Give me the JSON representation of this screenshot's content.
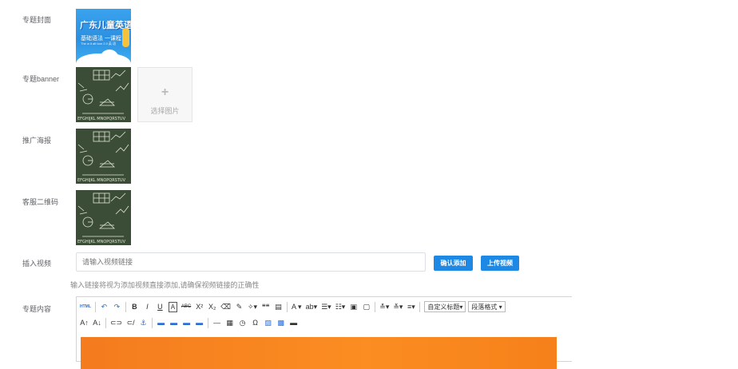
{
  "labels": {
    "cover": "专题封面",
    "banner": "专题banner",
    "poster": "推广海报",
    "qrcode": "客服二维码",
    "video": "插入视频",
    "content": "专题内容"
  },
  "cover_image": {
    "title": "广东儿童英语",
    "subtitle": "基础语法 一课程",
    "small": "The w it alt bon 2.0 英 语"
  },
  "picker": {
    "plus": "+",
    "text": "选择图片"
  },
  "video": {
    "placeholder": "请输入视频链接",
    "confirm_label": "确认添加",
    "upload_label": "上传视频",
    "hint": "输入链接将视为添加视频直接添加,请确保视频链接的正确性"
  },
  "toolbar": {
    "row1": [
      {
        "icon": "html-source-icon",
        "text": "HTML",
        "blue": true
      },
      {
        "sep": true
      },
      {
        "icon": "undo-icon",
        "text": "↶",
        "blue": true
      },
      {
        "icon": "redo-icon",
        "text": "↷",
        "blue": true
      },
      {
        "sep": true
      },
      {
        "icon": "bold-icon",
        "text": "B"
      },
      {
        "icon": "italic-icon",
        "text": "I"
      },
      {
        "icon": "underline-icon",
        "text": "U"
      },
      {
        "icon": "font-border-icon",
        "text": "A"
      },
      {
        "icon": "strikethrough-icon",
        "text": "ABC"
      },
      {
        "icon": "superscript-icon",
        "text": "X²"
      },
      {
        "icon": "subscript-icon",
        "text": "X₂"
      },
      {
        "icon": "eraser-icon",
        "text": "⌫"
      },
      {
        "icon": "format-brush-icon",
        "text": "✎"
      },
      {
        "icon": "auto-format-icon",
        "text": "✧▾"
      },
      {
        "icon": "blockquote-icon",
        "text": "❝❝"
      },
      {
        "icon": "paste-plain-icon",
        "text": "▤"
      },
      {
        "sep": true
      },
      {
        "icon": "font-color-icon",
        "text": "A ▾"
      },
      {
        "icon": "highlight-icon",
        "text": "ab▾"
      },
      {
        "icon": "ordered-list-icon",
        "text": "☰▾"
      },
      {
        "icon": "unordered-list-icon",
        "text": "☷▾"
      },
      {
        "icon": "select-all-icon",
        "text": "▣"
      },
      {
        "icon": "clear-doc-icon",
        "text": "▢"
      },
      {
        "sep": true
      },
      {
        "icon": "row-spacing-top-icon",
        "text": "≛▾"
      },
      {
        "icon": "row-spacing-bottom-icon",
        "text": "≚▾"
      },
      {
        "icon": "line-height-icon",
        "text": "≡▾"
      },
      {
        "sep": true
      },
      {
        "combo": true,
        "name": "custom-title-select",
        "text": "自定义标题▾"
      },
      {
        "combo": true,
        "name": "paragraph-format-select",
        "text": "段落格式 ▾"
      }
    ],
    "row2": [
      {
        "icon": "font-size-increase-icon",
        "text": "A↑"
      },
      {
        "icon": "font-size-decrease-icon",
        "text": "A↓"
      },
      {
        "sep": true
      },
      {
        "icon": "link-icon",
        "text": "⊂⊃"
      },
      {
        "icon": "unlink-icon",
        "text": "⊂/"
      },
      {
        "icon": "anchor-icon",
        "text": "⚓",
        "blue": true
      },
      {
        "sep": true
      },
      {
        "icon": "image-none-icon",
        "text": "▬",
        "blue": true
      },
      {
        "icon": "image-left-icon",
        "text": "▬",
        "blue": true
      },
      {
        "icon": "image-right-icon",
        "text": "▬",
        "blue": true
      },
      {
        "icon": "image-center-icon",
        "text": "▬",
        "blue": true
      },
      {
        "sep": true
      },
      {
        "icon": "horizontal-line-icon",
        "text": "—"
      },
      {
        "icon": "date-icon",
        "text": "▦"
      },
      {
        "icon": "time-icon",
        "text": "◷"
      },
      {
        "icon": "special-char-icon",
        "text": "Ω"
      },
      {
        "icon": "insert-image-icon",
        "text": "▨",
        "blue": true
      },
      {
        "icon": "insert-video-icon",
        "text": "▩",
        "blue": true
      },
      {
        "icon": "insert-media-icon",
        "text": "▬"
      }
    ]
  },
  "colors": {
    "primary": "#1e88e5",
    "cover_bg": "#2b8fe0",
    "board_bg": "#3b4d36",
    "content_orange": "#f6801a"
  }
}
